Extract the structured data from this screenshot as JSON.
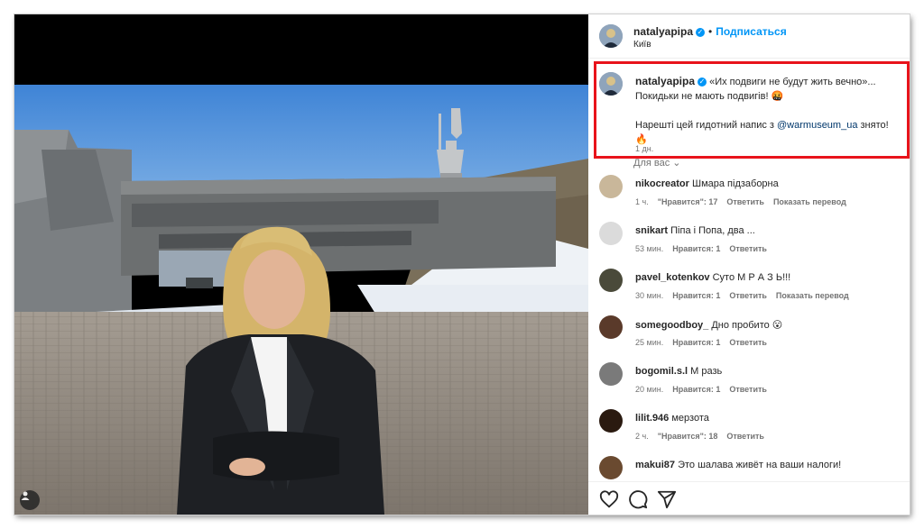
{
  "post": {
    "author": "natalyapipa",
    "follow_label": "Подписаться",
    "location": "Київ",
    "separator": "•"
  },
  "caption": {
    "author": "natalyapipa",
    "line1": " «Их подвиги не будут жить вечно»...",
    "line2": "Покидьки не мають подвигів! 🤬",
    "line3_prefix": "Нарешті цей гидотний напис з ",
    "mention": "@warmuseum_ua",
    "line3_suffix": " знято! 🔥",
    "time": "1 дн."
  },
  "for_you_label": "Для вас",
  "comments": [
    {
      "user": "nikocreator",
      "text": "Шмара підзаборна",
      "time": "1 ч.",
      "likes": "\"Нравится\": 17",
      "reply": "Ответить",
      "translate": "Показать перевод",
      "avatar_color": "#c9b79a"
    },
    {
      "user": "snikart",
      "text": "Піпа і Попа, два ...",
      "time": "53 мин.",
      "likes": "Нравится: 1",
      "reply": "Ответить",
      "translate": "",
      "avatar_color": "#dbdbdb"
    },
    {
      "user": "pavel_kotenkov",
      "text": "Суто М Р А З Ь!!!",
      "time": "30 мин.",
      "likes": "Нравится: 1",
      "reply": "Ответить",
      "translate": "Показать перевод",
      "avatar_color": "#4a4a3a"
    },
    {
      "user": "somegoodboy_",
      "text": "Дно пробито 😮",
      "time": "25 мин.",
      "likes": "Нравится: 1",
      "reply": "Ответить",
      "translate": "",
      "avatar_color": "#5a3a2a"
    },
    {
      "user": "bogomil.s.l",
      "text": "М разь",
      "time": "20 мин.",
      "likes": "Нравится: 1",
      "reply": "Ответить",
      "translate": "",
      "avatar_color": "#7a7a7a"
    },
    {
      "user": "lilit.946",
      "text": "мерзота",
      "time": "2 ч.",
      "likes": "\"Нравится\": 18",
      "reply": "Ответить",
      "translate": "",
      "avatar_color": "#2a1a10"
    },
    {
      "user": "makui87",
      "text": "Это шалава живёт на ваши налоги!",
      "time": "",
      "likes": "",
      "reply": "",
      "translate": "",
      "avatar_color": "#6a4a30"
    }
  ],
  "icons": {
    "like": "heart-icon",
    "comment": "comment-icon",
    "share": "share-icon",
    "tag": "user-tag-icon"
  }
}
